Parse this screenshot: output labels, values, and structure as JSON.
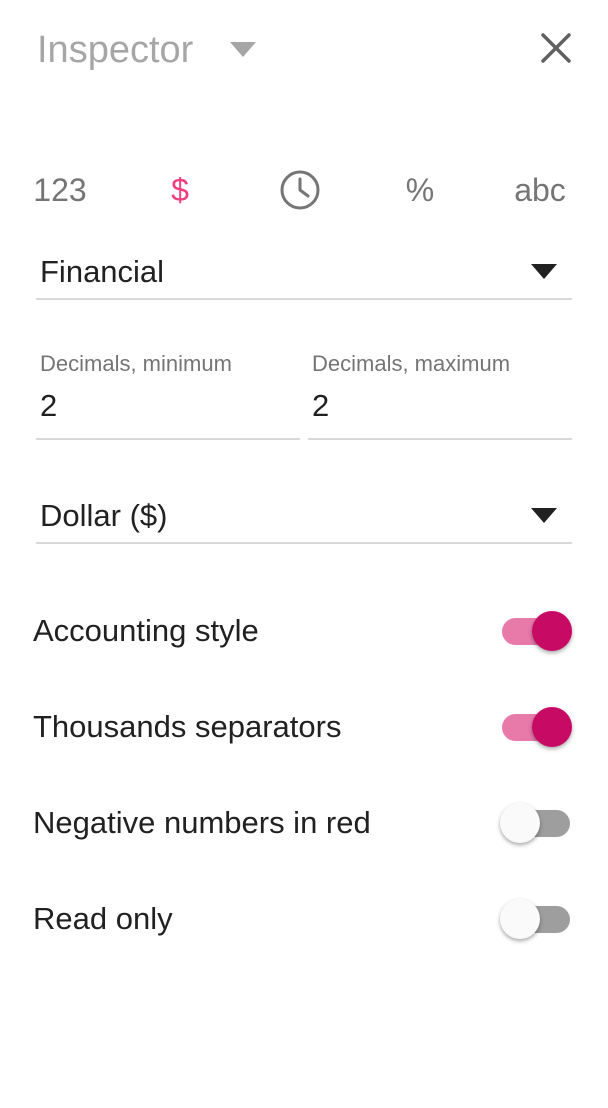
{
  "header": {
    "title": "Inspector"
  },
  "format_types": [
    {
      "label": "123",
      "icon": "number-icon",
      "active": false
    },
    {
      "label": "$",
      "icon": "currency-icon",
      "active": true
    },
    {
      "label": "",
      "icon": "clock-icon",
      "active": false
    },
    {
      "label": "%",
      "icon": "percent-icon",
      "active": false
    },
    {
      "label": "abc",
      "icon": "text-icon",
      "active": false
    }
  ],
  "format_select": {
    "value": "Financial"
  },
  "decimals": {
    "min_label": "Decimals, minimum",
    "min_value": "2",
    "max_label": "Decimals, maximum",
    "max_value": "2"
  },
  "currency_select": {
    "value": "Dollar ($)"
  },
  "options": [
    {
      "label": "Accounting style",
      "on": true
    },
    {
      "label": "Thousands separators",
      "on": true
    },
    {
      "label": "Negative numbers in red",
      "on": false
    },
    {
      "label": "Read only",
      "on": false
    }
  ],
  "colors": {
    "accent": "#c70a64",
    "accent_light": "#e87aaa",
    "active_icon": "#f0407a",
    "muted": "#757575"
  }
}
